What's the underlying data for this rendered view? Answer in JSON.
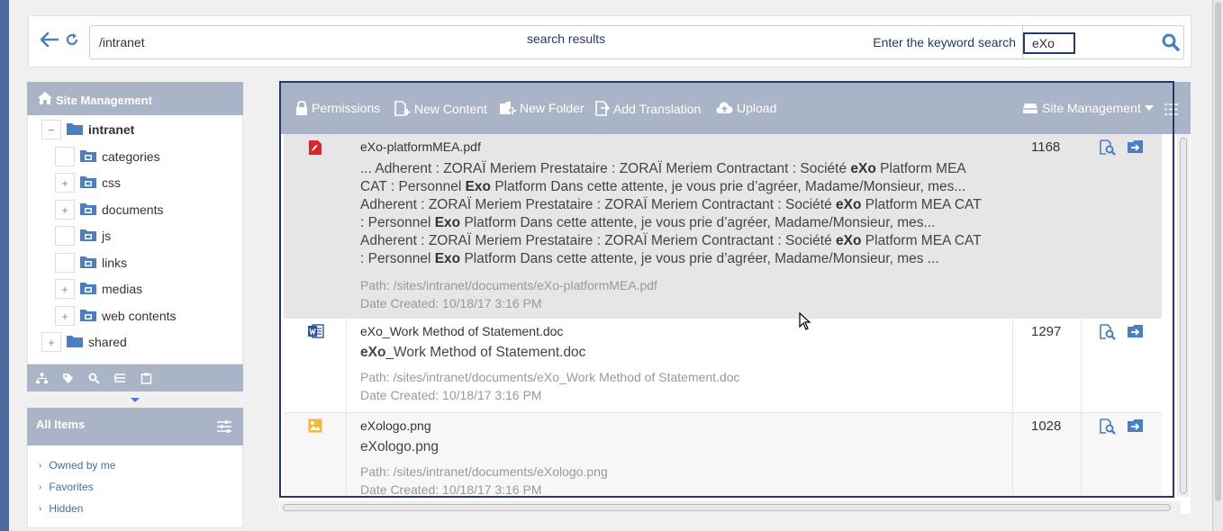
{
  "address": {
    "path": "/intranet",
    "center_label": "search results",
    "keyword_placeholder": "Enter the keyword search",
    "search_value": "eXo"
  },
  "sidebar": {
    "title": "Site Management",
    "tree": [
      {
        "label": "intranet",
        "expander": "−",
        "level": 0,
        "bold": true
      },
      {
        "label": "categories",
        "expander": "",
        "level": 1
      },
      {
        "label": "css",
        "expander": "+",
        "level": 1
      },
      {
        "label": "documents",
        "expander": "+",
        "level": 1
      },
      {
        "label": "js",
        "expander": "",
        "level": 1
      },
      {
        "label": "links",
        "expander": "",
        "level": 1
      },
      {
        "label": "medias",
        "expander": "+",
        "level": 1
      },
      {
        "label": "web contents",
        "expander": "+",
        "level": 1
      },
      {
        "label": "shared",
        "expander": "+",
        "level": 0
      }
    ],
    "all_items_title": "All Items",
    "all_items": [
      "Owned by me",
      "Favorites",
      "Hidden"
    ]
  },
  "toolbar": {
    "permissions": "Permissions",
    "new_content": "New Content",
    "new_folder": "New Folder",
    "add_translation": "Add Translation",
    "upload": "Upload",
    "drive": "Site Management"
  },
  "results": [
    {
      "name": "eXo-platformMEA.pdf",
      "type": "pdf",
      "score": "1168",
      "excerpt_lines": [
        [
          "... Adherent : ZORAÏ Meriem Prestataire : ZORAÏ Meriem Contractant : Société ",
          "eXo",
          " Platform MEA"
        ],
        [
          "CAT : Personnel ",
          "Exo",
          " Platform Dans cette attente, je vous prie d’agréer, Madame/Monsieur, mes..."
        ],
        [
          "Adherent : ZORAÏ Meriem Prestataire : ZORAÏ Meriem Contractant : Société ",
          "eXo",
          " Platform MEA CAT"
        ],
        [
          ": Personnel ",
          "Exo",
          " Platform Dans cette attente, je vous prie d’agréer, Madame/Monsieur, mes..."
        ],
        [
          "Adherent : ZORAÏ Meriem Prestataire : ZORAÏ Meriem Contractant : Société ",
          "eXo",
          " Platform MEA CAT"
        ],
        [
          ": Personnel ",
          "Exo",
          " Platform Dans cette attente, je vous prie d’agréer, Madame/Monsieur, mes ..."
        ]
      ],
      "path": "Path: /sites/intranet/documents/eXo-platformMEA.pdf",
      "date": "Date Created: 10/18/17 3:16 PM"
    },
    {
      "name": "eXo_Work Method of Statement.doc",
      "type": "doc",
      "score": "1297",
      "title_bold": "eXo",
      "title_rest": "_Work Method of Statement.doc",
      "path": "Path: /sites/intranet/documents/eXo_Work Method of Statement.doc",
      "date": "Date Created: 10/18/17 3:16 PM"
    },
    {
      "name": "eXologo.png",
      "type": "png",
      "score": "1028",
      "title_bold": "",
      "title_rest": "eXologo.png",
      "path": "Path: /sites/intranet/documents/eXologo.png",
      "date": "Date Created: 10/18/17 3:16 PM"
    }
  ],
  "colors": {
    "accent": "#4a7fc1",
    "header_bg": "#a9b4c6",
    "selection": "#233a6b",
    "pdf": "#d9262c",
    "doc": "#2b579a",
    "png": "#f0b93b"
  }
}
